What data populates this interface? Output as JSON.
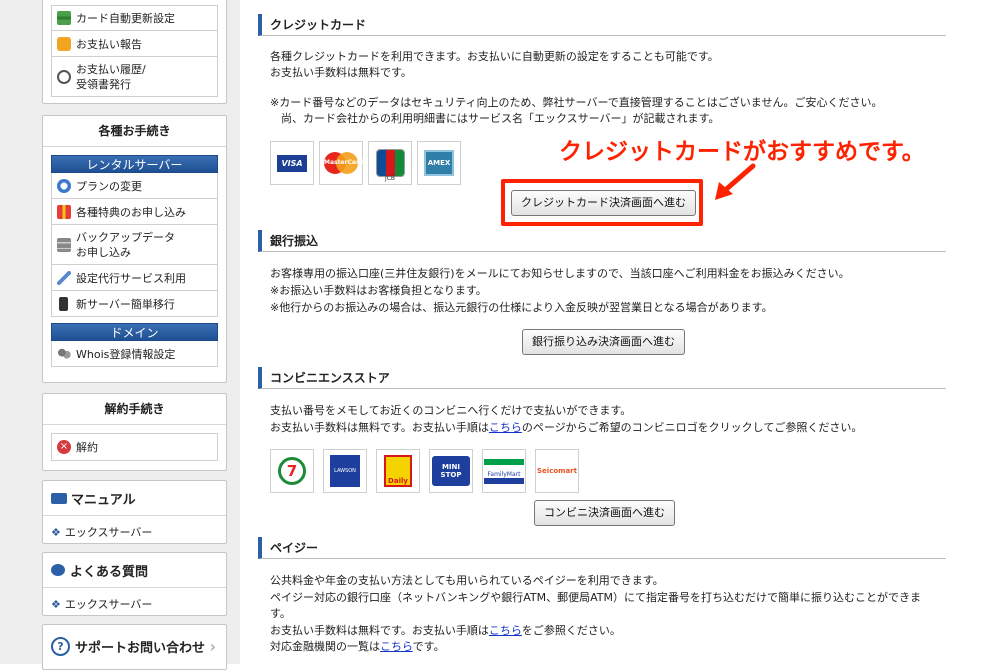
{
  "sidebar": {
    "top_items": [
      {
        "label": "カード自動更新設定",
        "icon": "credit-card-icon"
      },
      {
        "label": "お支払い報告",
        "icon": "speech-bubble-icon"
      },
      {
        "label_1": "お支払い履歴/",
        "label_2": "受領書発行",
        "icon": "clock-icon"
      }
    ],
    "procedures": {
      "title": "各種お手続き",
      "rental_header": "レンタルサーバー",
      "rental_items": [
        {
          "label": "プランの変更",
          "icon": "refresh-arrows-icon"
        },
        {
          "label": "各種特典のお申し込み",
          "icon": "gift-icon"
        },
        {
          "label_1": "バックアップデータ",
          "label_2": "お申し込み",
          "icon": "backup-server-icon"
        },
        {
          "label": "設定代行サービス利用",
          "icon": "wrench-icon"
        },
        {
          "label": "新サーバー簡単移行",
          "icon": "server-icon"
        }
      ],
      "domain_header": "ドメイン",
      "domain_items": [
        {
          "label": "Whois登録情報設定",
          "icon": "users-icon"
        }
      ]
    },
    "cancel": {
      "title": "解約手続き",
      "item": "解約",
      "icon": "cancel-x-icon"
    },
    "manual": {
      "title": "マニュアル",
      "link": "エックスサーバー",
      "icon": "book-icon"
    },
    "faq": {
      "title": "よくある質問",
      "link": "エックスサーバー",
      "icon": "chat-bubble-icon"
    },
    "support": {
      "title": "サポートお問い合わせ",
      "icon": "question-circle-icon",
      "chevron": "›"
    }
  },
  "main": {
    "credit": {
      "title": "クレジットカード",
      "line1": "各種クレジットカードを利用できます。お支払いに自動更新の設定をすることも可能です。",
      "line2": "お支払い手数料は無料です。",
      "note1": "※カード番号などのデータはセキュリティ向上のため、弊社サーバーで直接管理することはございません。ご安心ください。",
      "note2": "尚、カード会社からの利用明細書にはサービス名「エックスサーバー」が記載されます。",
      "logos": [
        "VISA",
        "MasterCard",
        "JCB",
        "AMEX"
      ],
      "button": "クレジットカード決済画面へ進む",
      "annotation": "クレジットカードがおすすめです。",
      "highlight_color": "#ff2200"
    },
    "bank": {
      "title": "銀行振込",
      "line1": "お客様専用の振込口座(三井住友銀行)をメールにてお知らせしますので、当該口座へご利用料金をお振込みください。",
      "line2": "※お振込い手数料はお客様負担となります。",
      "line3": "※他行からのお振込みの場合は、振込元銀行の仕様により入金反映が翌営業日となる場合があります。",
      "button": "銀行振り込み決済画面へ進む"
    },
    "convenience": {
      "title": "コンビニエンスストア",
      "line1": "支払い番号をメモしてお近くのコンビニへ行くだけで支払いができます。",
      "line2_pre": "お支払い手数料は無料です。お支払い手順は",
      "line2_link": "こちら",
      "line2_post": "のページからご希望のコンビニロゴをクリックしてご参照ください。",
      "logos": [
        "7",
        "LAWSON",
        "Daily",
        "MINI STOP",
        "FamilyMart",
        "Seicomart"
      ],
      "button": "コンビニ決済画面へ進む"
    },
    "payeasy": {
      "title": "ペイジー",
      "line1": "公共料金や年金の支払い方法としても用いられているペイジーを利用できます。",
      "line2a": "ペイジー対応の銀行口座（ネットバンキングや銀行ATM、郵便局ATM）にて指定番号を打ち込むだけで簡単に振り込むことができま",
      "line2b": "す。",
      "line3_pre": "お支払い手数料は無料です。お支払い手順は",
      "line3_link": "こちら",
      "line3_post": "をご参照ください。",
      "line4_pre": "対応金融機関の一覧は",
      "line4_link": "こちら",
      "line4_post": "です。"
    }
  }
}
